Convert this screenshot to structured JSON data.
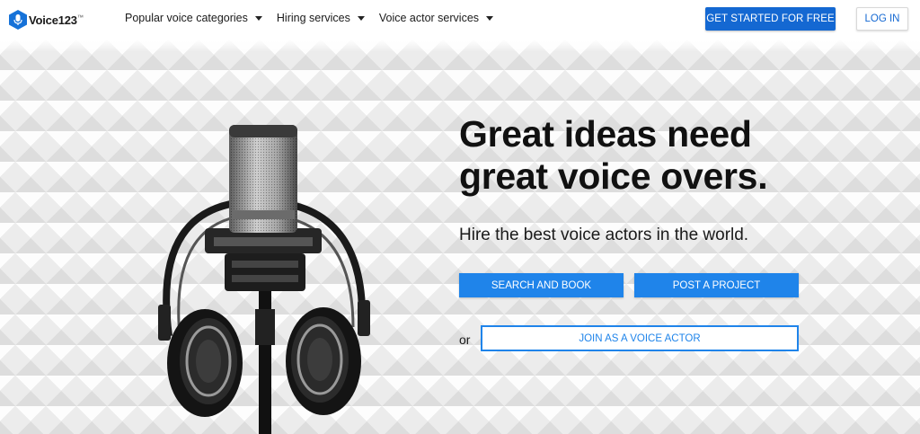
{
  "header": {
    "logo": {
      "text": "Voice123",
      "tm": "™",
      "icon": "microphone-hex-icon",
      "brand_color": "#1672d8"
    },
    "nav": [
      {
        "label": "Popular voice categories",
        "icon": "caret-down-icon"
      },
      {
        "label": "Hiring services",
        "icon": "caret-down-icon"
      },
      {
        "label": "Voice actor services",
        "icon": "caret-down-icon"
      }
    ],
    "get_started_label": "GET STARTED FOR FREE",
    "login_label": "LOG IN"
  },
  "hero": {
    "headline_line1": "Great ideas need",
    "headline_line2": "great voice overs.",
    "subheadline": "Hire the best voice actors in the world.",
    "search_button": "SEARCH AND BOOK",
    "post_button": "POST A PROJECT",
    "or_text": "or",
    "join_button": "JOIN AS A VOICE ACTOR",
    "image": "microphone-with-headphones-image"
  },
  "colors": {
    "primary": "#1468d2",
    "accent": "#1f84ea",
    "text": "#111111"
  }
}
